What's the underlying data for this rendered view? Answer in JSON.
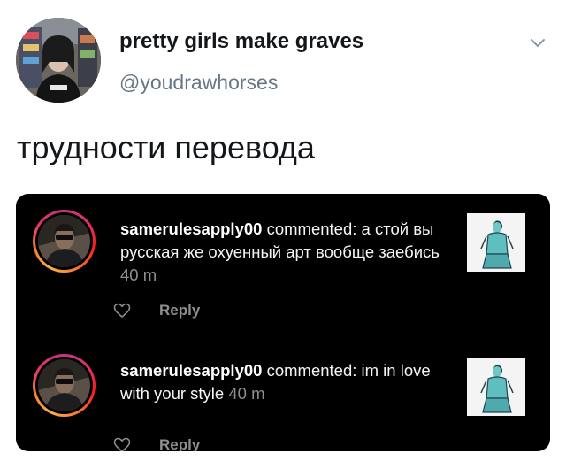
{
  "tweet": {
    "display_name": "pretty girls make graves",
    "handle": "@youdrawhorses",
    "text": "трудности перевода",
    "avatar_icon": "profile-photo",
    "menu_icon": "chevron-down-icon"
  },
  "screenshot": {
    "notifications": [
      {
        "username": "samerulesapply00",
        "action": " commented: ",
        "comment": "а стой вы русская же охуенный арт вообще заебись",
        "time": "40 m",
        "reply_label": "Reply"
      },
      {
        "username": "samerulesapply00",
        "action": " commented: ",
        "comment": "im in love with your style",
        "time": "40 m",
        "reply_label": "Reply"
      }
    ]
  },
  "colors": {
    "text": "#14171a",
    "muted": "#657786",
    "panel": "#000000",
    "panel_muted": "#8e8e8e"
  }
}
